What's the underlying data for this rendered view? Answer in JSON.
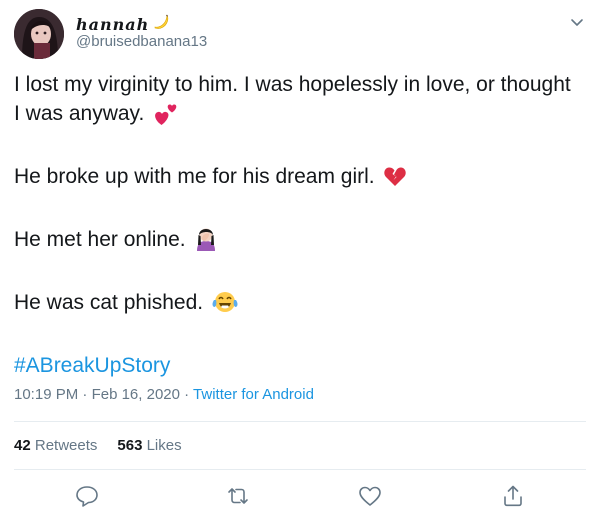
{
  "user": {
    "display_name": "hannah",
    "handle": "@bruisedbanana13"
  },
  "tweet": {
    "paragraphs": [
      "I lost my virginity to him. I was hopelessly in love, or thought I was anyway.",
      "He broke up with me for his dream girl.",
      "He met her online.",
      "He was cat phished."
    ],
    "hashtag": "#ABreakUpStory",
    "emojis": [
      "two-hearts-icon",
      "broken-heart-icon",
      "facepalm-icon",
      "tears-of-joy-icon"
    ]
  },
  "meta": {
    "time": "10:19 PM",
    "separator": "·",
    "date": "Feb 16, 2020",
    "source": "Twitter for Android"
  },
  "stats": {
    "retweets_count": "42",
    "retweets_label": "Retweets",
    "likes_count": "563",
    "likes_label": "Likes"
  },
  "colors": {
    "link": "#1b95e0",
    "secondary_text": "#657786",
    "divider": "#e6ecf0"
  }
}
